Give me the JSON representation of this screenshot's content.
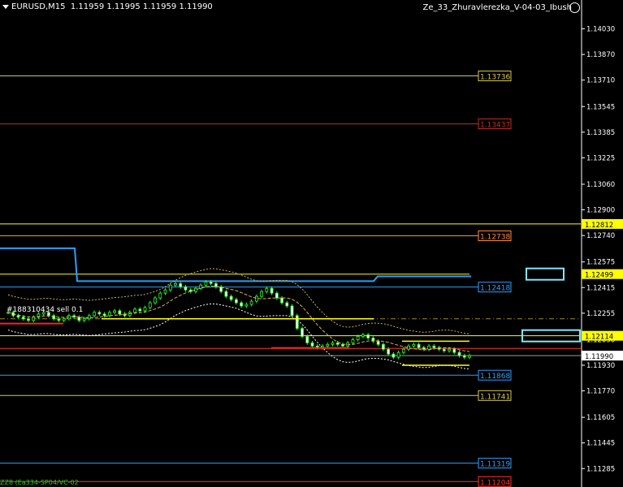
{
  "header": {
    "symbol_info": "EURUSD,M15",
    "ohlc": "1.11959 1.11995 1.11959 1.11990",
    "expert": "Ze_33_Zhuravlerezka_V-04-03_Ibush",
    "trade_label": "#188310434 sell 0.1",
    "bottom_label": "ZZ8 (Ea334-SP04/VC-02"
  },
  "colors": {
    "background": "#000000",
    "grid": "#ffffff",
    "yellow": "#ffff00",
    "khaki": "#d6c84a",
    "red": "#ff2020",
    "darkred": "#c03020",
    "orange": "#ff8c3a",
    "blue": "#2aa0ff",
    "cyan": "#7fe8ff",
    "green": "#22ff22",
    "darkgreen": "#0a6a0a"
  },
  "chart_data": {
    "type": "candlestick",
    "symbol": "EURUSD",
    "timeframe": "M15",
    "ylim": [
      1.1117,
      1.1421
    ],
    "y_ticks": [
      "1.14030",
      "1.13870",
      "1.13710",
      "1.13545",
      "1.13385",
      "1.13225",
      "1.13060",
      "1.12900",
      "1.12740",
      "1.12575",
      "1.12415",
      "1.12255",
      "1.12090",
      "1.11930",
      "1.11770",
      "1.11605",
      "1.11445",
      "1.11285"
    ],
    "current_price": "1.11990",
    "axis_price_labels": [
      {
        "text": "1.12812",
        "bg": "#ffff00"
      },
      {
        "text": "1.12499",
        "bg": "#ffff00"
      },
      {
        "text": "1.12114",
        "bg": "#ffff00"
      },
      {
        "text": "1.11990",
        "bg": "#ffffff"
      }
    ],
    "levels": [
      {
        "price": 1.13736,
        "label": "1.13736",
        "color": "#d6c84a",
        "x1": 0,
        "x2": 590
      },
      {
        "price": 1.13437,
        "label": "1.13437",
        "color": "#c03020",
        "x1": 0,
        "x2": 590
      },
      {
        "price": 1.12812,
        "label": "",
        "color": "#ffff00",
        "x1": 0,
        "x2": 715
      },
      {
        "price": 1.12738,
        "label": "1.12738",
        "color": "#ff8c3a",
        "x1": 0,
        "x2": 590
      },
      {
        "price": 1.12499,
        "label": "",
        "color": "#ffff00",
        "x1": 0,
        "x2": 578
      },
      {
        "price": 1.12418,
        "label": "1.12418",
        "color": "#2aa0ff",
        "x1": 0,
        "x2": 590
      },
      {
        "price": 1.12114,
        "label": "",
        "color": "#ffff00",
        "x1": 0,
        "x2": 715
      },
      {
        "price": 1.12035,
        "label": "",
        "color": "#ff3030",
        "x1": 0,
        "x2": 715
      },
      {
        "price": 1.1199,
        "label": "",
        "color": "#9a9a9a",
        "x1": 0,
        "x2": 715
      },
      {
        "price": 1.11868,
        "label": "1.11868",
        "color": "#2aa0ff",
        "x1": 0,
        "x2": 590
      },
      {
        "price": 1.11741,
        "label": "1.11741",
        "color": "#d6c84a",
        "x1": 0,
        "x2": 590
      },
      {
        "price": 1.11319,
        "label": "1.11319",
        "color": "#2aa0ff",
        "x1": 0,
        "x2": 590
      },
      {
        "price": 1.11204,
        "label": "1.11204",
        "color": "#ff3030",
        "x1": 0,
        "x2": 590
      }
    ],
    "dashdot_level": {
      "price": 1.1222,
      "color": "#9a8a20"
    },
    "closes": [
      1.1226,
      1.1224,
      1.1223,
      1.1222,
      1.1221,
      1.1223,
      1.1225,
      1.1226,
      1.1224,
      1.1222,
      1.1221,
      1.1222,
      1.1224,
      1.1223,
      1.1221,
      1.1222,
      1.1224,
      1.1226,
      1.1225,
      1.1224,
      1.1226,
      1.1227,
      1.1225,
      1.1224,
      1.1226,
      1.1228,
      1.1227,
      1.1229,
      1.1232,
      1.1235,
      1.1238,
      1.124,
      1.1243,
      1.1244,
      1.1242,
      1.124,
      1.1239,
      1.1241,
      1.1243,
      1.1245,
      1.1244,
      1.1242,
      1.1239,
      1.1236,
      1.1234,
      1.1232,
      1.123,
      1.1231,
      1.1233,
      1.1236,
      1.1239,
      1.1241,
      1.1238,
      1.1235,
      1.1232,
      1.123,
      1.1224,
      1.1216,
      1.1211,
      1.1207,
      1.1205,
      1.1204,
      1.1205,
      1.1206,
      1.1207,
      1.1206,
      1.1205,
      1.1207,
      1.1209,
      1.1211,
      1.1212,
      1.121,
      1.1208,
      1.1206,
      1.1203,
      1.12,
      1.1198,
      1.1201,
      1.1203,
      1.1205,
      1.1206,
      1.1204,
      1.1203,
      1.1205,
      1.1204,
      1.1203,
      1.1202,
      1.1203,
      1.1201,
      1.1199,
      1.1198,
      1.1199
    ]
  }
}
